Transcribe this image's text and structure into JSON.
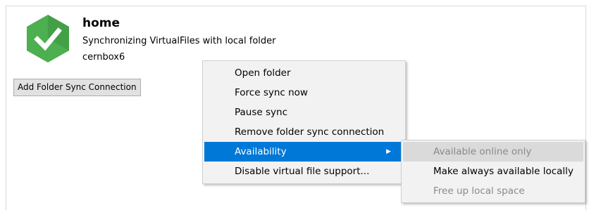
{
  "folder": {
    "title": "home",
    "status": "Synchronizing VirtualFiles with local folder",
    "account": "cernbox6",
    "icon": "sync-ok-icon",
    "icon_color": "#4caf50"
  },
  "add_button": {
    "label": "Add Folder Sync Connection"
  },
  "context_menu": {
    "items": [
      {
        "label": "Open folder"
      },
      {
        "label": "Force sync now"
      },
      {
        "label": "Pause sync"
      },
      {
        "label": "Remove folder sync connection"
      },
      {
        "label": "Availability",
        "has_submenu": true,
        "highlighted": true
      },
      {
        "label": "Disable virtual file support..."
      }
    ],
    "highlight_color": "#0078d7"
  },
  "availability_submenu": {
    "items": [
      {
        "label": "Available online only",
        "enabled": false
      },
      {
        "label": "Make always available locally",
        "enabled": true
      },
      {
        "label": "Free up local space",
        "enabled": false
      }
    ]
  }
}
